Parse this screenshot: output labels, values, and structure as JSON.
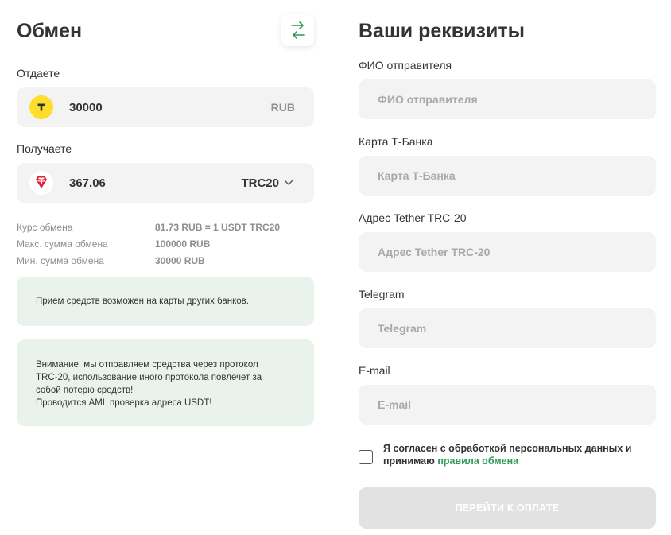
{
  "exchange": {
    "title": "Обмен",
    "give_label": "Отдаете",
    "give_amount": "30000",
    "give_currency": "RUB",
    "get_label": "Получаете",
    "get_amount": "367.06",
    "get_currency": "TRC20",
    "give_coin_icon": "tbank-logo-icon",
    "get_coin_icon": "tether-logo-icon",
    "info": [
      {
        "label": "Курс обмена",
        "value": "81.73 RUB = 1 USDT TRC20"
      },
      {
        "label": "Макс. сумма обмена",
        "value": "100000 RUB"
      },
      {
        "label": "Мин. сумма обмена",
        "value": "30000 RUB"
      }
    ],
    "note1": "Прием средств возможен на карты других банков.",
    "note2_lines": [
      "Внимание: мы отправляем средства через протокол",
      "TRC-20, использование иного протокола повлечет за",
      "собой потерю средств!",
      "Проводится AML проверка адреса USDT!"
    ]
  },
  "details": {
    "title": "Ваши реквизиты",
    "fields": [
      {
        "label": "ФИО отправителя",
        "placeholder": "ФИО отправителя",
        "value": ""
      },
      {
        "label": "Карта Т-Банка",
        "placeholder": "Карта Т-Банка",
        "value": ""
      },
      {
        "label": "Адрес Tether TRC-20",
        "placeholder": "Адрес Tether TRC-20",
        "value": ""
      },
      {
        "label": "Telegram",
        "placeholder": "Telegram",
        "value": ""
      },
      {
        "label": "E-mail",
        "placeholder": "E-mail",
        "value": ""
      }
    ],
    "agree_text": "Я согласен с обработкой персональных данных и принимаю",
    "agree_link": "правила обмена",
    "pay_button": "ПЕРЕЙТИ К ОПЛАТЕ"
  },
  "colors": {
    "accent_green": "#2f9a59",
    "field_bg": "#f2f3f2",
    "note_bg": "#e9f3ec",
    "tbank_yellow": "#ffdd2d",
    "tether_red": "#e0203a"
  }
}
